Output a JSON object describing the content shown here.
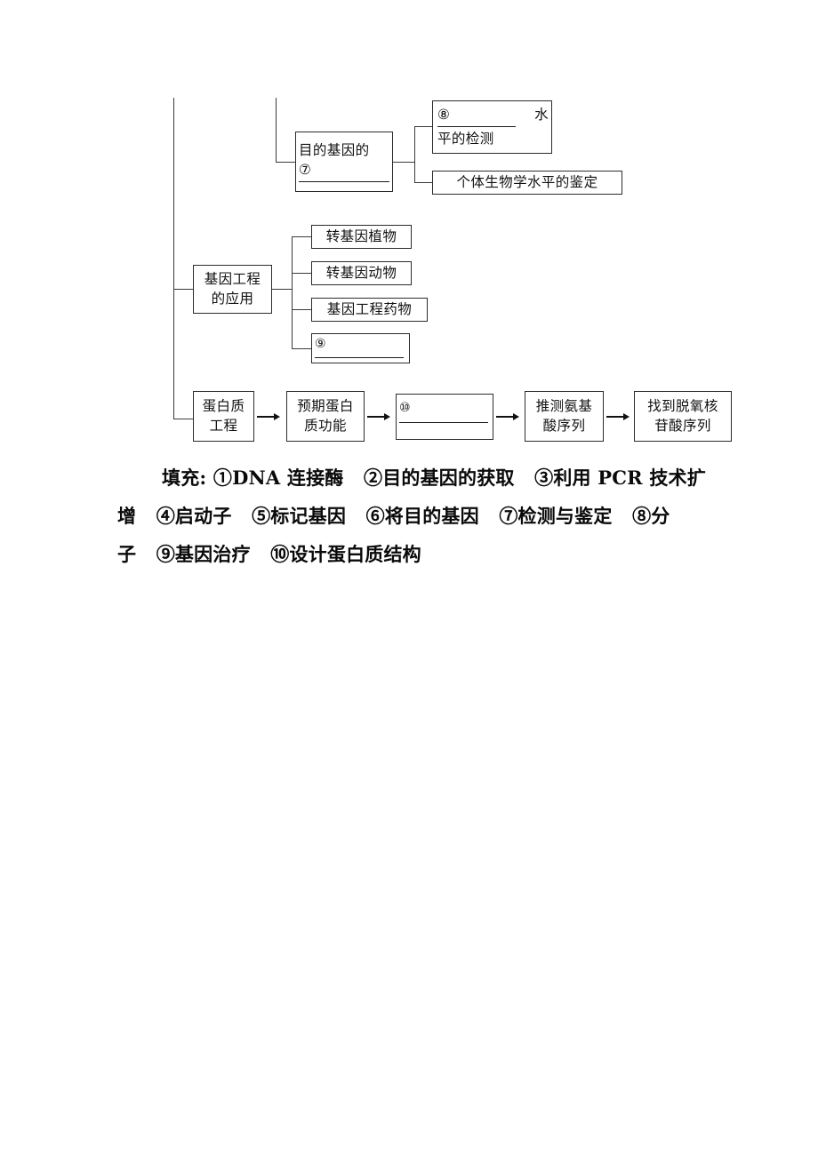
{
  "document": {
    "type": "concept-map-worksheet",
    "subject_hint": "基因工程与蛋白质工程"
  },
  "diagram": {
    "branch_detection": {
      "parent": {
        "line1": "目的基因的",
        "blank_number": "⑦",
        "has_blank": true
      },
      "children": [
        {
          "blank_number": "⑧",
          "line1_suffix": "水",
          "line2": "平的检测",
          "has_blank": true
        },
        {
          "label": "个体生物学水平的鉴定",
          "has_blank": false
        }
      ]
    },
    "branch_application": {
      "parent": {
        "line1": "基因工程",
        "line2": "的应用"
      },
      "children": [
        {
          "label": "转基因植物",
          "has_blank": false
        },
        {
          "label": "转基因动物",
          "has_blank": false
        },
        {
          "label": "基因工程药物",
          "has_blank": false
        },
        {
          "blank_number": "⑨",
          "label": "",
          "has_blank": true
        }
      ]
    },
    "flow_protein_engineering": {
      "steps": [
        {
          "line1": "蛋白质",
          "line2": "工程",
          "has_blank": false
        },
        {
          "line1": "预期蛋白",
          "line2": "质功能",
          "has_blank": false
        },
        {
          "blank_number": "⑩",
          "label": "",
          "has_blank": true
        },
        {
          "line1": "推测氨基",
          "line2": "酸序列",
          "has_blank": false
        },
        {
          "line1": "找到脱氧核",
          "line2": "苷酸序列",
          "has_blank": false
        }
      ],
      "arrow_glyph": "→"
    }
  },
  "answers": {
    "label": "填充:",
    "lines": [
      "填充: ①DNA 连接酶   ②目的基因的获取   ③利用 PCR 技术扩",
      "增   ④启动子   ⑤标记基因   ⑥将目的基因   ⑦检测与鉴定   ⑧分",
      "子   ⑨基因治疗   ⑩设计蛋白质结构"
    ],
    "items": [
      {
        "number": "①",
        "text": "DNA 连接酶"
      },
      {
        "number": "②",
        "text": "目的基因的获取"
      },
      {
        "number": "③",
        "text": "利用 PCR 技术扩增"
      },
      {
        "number": "④",
        "text": "启动子"
      },
      {
        "number": "⑤",
        "text": "标记基因"
      },
      {
        "number": "⑥",
        "text": "将目的基因"
      },
      {
        "number": "⑦",
        "text": "检测与鉴定"
      },
      {
        "number": "⑧",
        "text": "分子"
      },
      {
        "number": "⑨",
        "text": "基因治疗"
      },
      {
        "number": "⑩",
        "text": "设计蛋白质结构"
      }
    ]
  },
  "colors": {
    "ink": "#111111",
    "rule": "#3a3a3a",
    "page": "#ffffff"
  }
}
